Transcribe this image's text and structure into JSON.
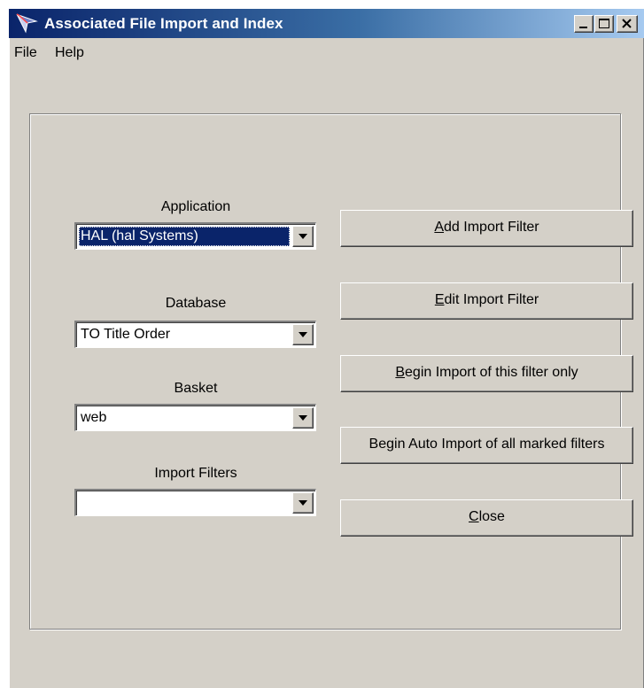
{
  "window": {
    "title": "Associated File Import and Index"
  },
  "menu": {
    "items": [
      "File",
      "Help"
    ]
  },
  "form": {
    "application": {
      "label": "Application",
      "value": "HAL  (hal Systems)"
    },
    "database": {
      "label": "Database",
      "value": "TO Title Order"
    },
    "basket": {
      "label": "Basket",
      "value": "web"
    },
    "import_filters": {
      "label": "Import Filters",
      "value": ""
    }
  },
  "buttons": {
    "add": {
      "accel": "A",
      "rest": "dd Import Filter"
    },
    "edit": {
      "accel": "E",
      "rest": "dit Import Filter"
    },
    "begin": {
      "accel": "B",
      "rest": "egin Import of this filter only"
    },
    "auto": {
      "label": "Begin Auto Import of all marked filters"
    },
    "close": {
      "accel": "C",
      "rest": "lose"
    }
  },
  "colors": {
    "titlebar_start": "#0a246a",
    "titlebar_end": "#a6caf0",
    "face": "#d4d0c8",
    "selection": "#0a246a"
  },
  "icons": [
    "app-icon",
    "minimize-icon",
    "maximize-icon",
    "close-icon",
    "dropdown-arrow-icon"
  ]
}
